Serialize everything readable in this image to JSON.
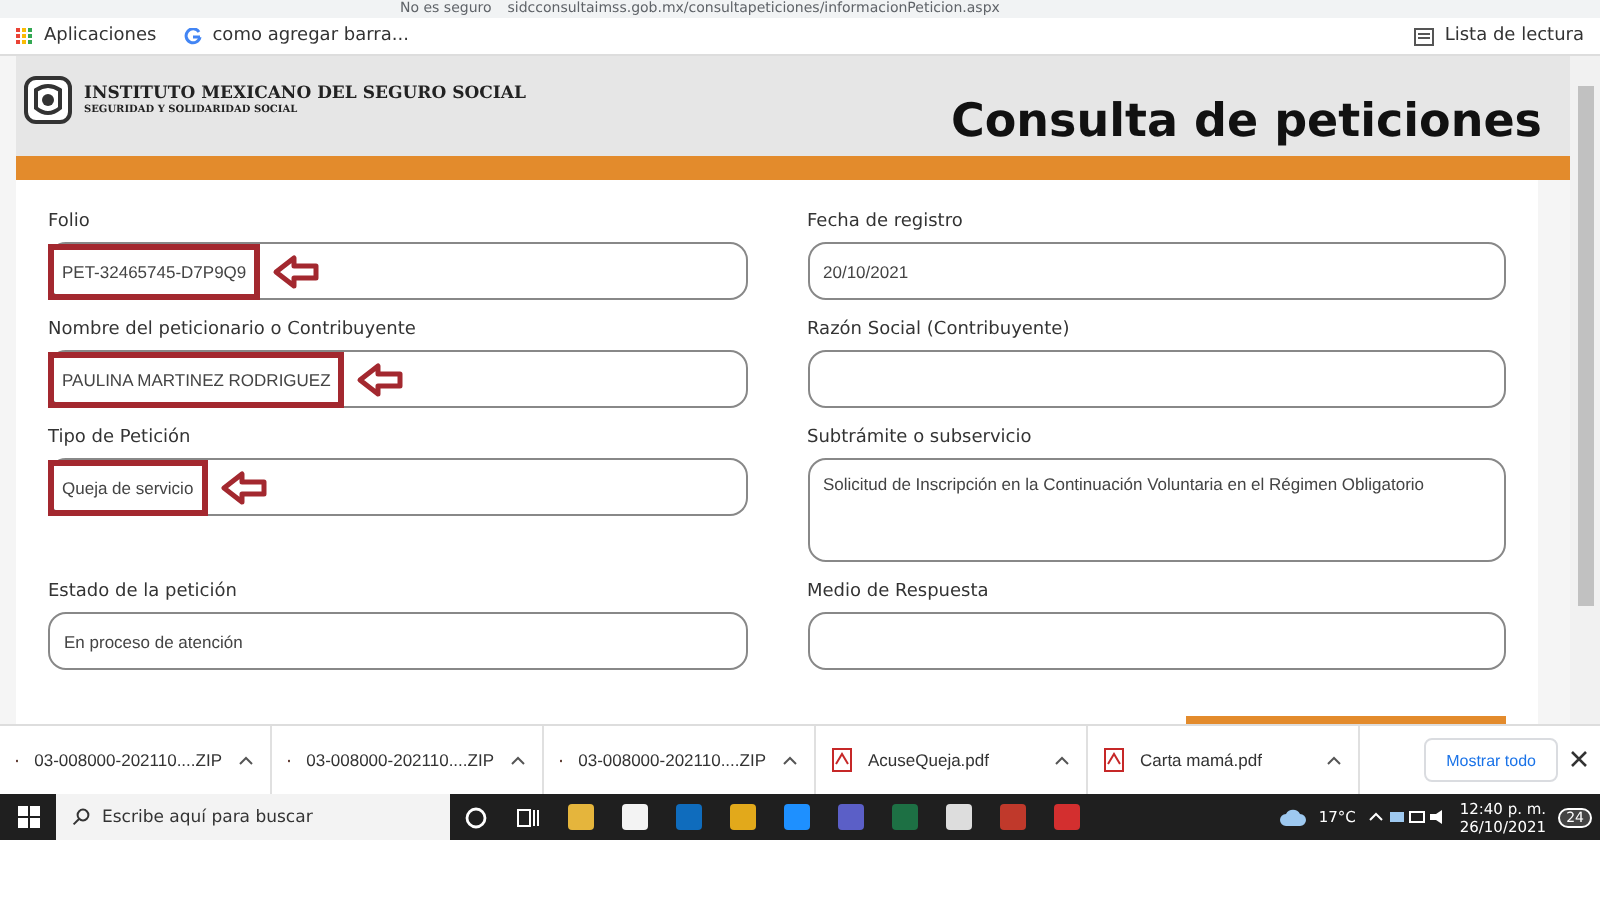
{
  "address_bar": {
    "security": "No es seguro",
    "url": "sidcconsultaimss.gob.mx/consultapeticiones/informacionPeticion.aspx"
  },
  "bookmarks": [
    {
      "label": "Aplicaciones",
      "kind": "apps"
    },
    {
      "label": "como agregar barra...",
      "kind": "google"
    }
  ],
  "reading_list": "Lista de lectura",
  "header": {
    "org_name": "INSTITUTO MEXICANO DEL SEGURO SOCIAL",
    "org_tagline": "SEGURIDAD Y SOLIDARIDAD SOCIAL",
    "title": "Consulta de peticiones"
  },
  "fields": [
    {
      "label": "Folio",
      "value": "PET-32465745-D7P9Q9",
      "highlighted": true,
      "tall": false
    },
    {
      "label": "Fecha de registro",
      "value": "20/10/2021",
      "highlighted": false,
      "tall": false
    },
    {
      "label": "Nombre del peticionario o Contribuyente",
      "value": "PAULINA MARTINEZ RODRIGUEZ",
      "highlighted": true,
      "tall": false
    },
    {
      "label": "Razón Social (Contribuyente)",
      "highlighted": false,
      "tall": false
    },
    {
      "label": "Tipo de Petición",
      "value": "Queja de servicio",
      "highlighted": true,
      "tall": false
    },
    {
      "label": "Subtrámite o subservicio",
      "value": "Solicitud de Inscripción en la Continuación Voluntaria en el Régimen Obligatorio",
      "highlighted": false,
      "tall": true
    },
    {
      "label": "Estado de la petición",
      "value": "En proceso de atención",
      "highlighted": false,
      "tall": false
    },
    {
      "label": "Medio de Respuesta",
      "highlighted": false,
      "tall": false
    }
  ],
  "downloads": [
    {
      "name": "03-008000-202110....ZIP",
      "kind": "zip"
    },
    {
      "name": "03-008000-202110....ZIP",
      "kind": "zip"
    },
    {
      "name": "03-008000-202110....ZIP",
      "kind": "zip"
    },
    {
      "name": "AcuseQueja.pdf",
      "kind": "pdf"
    },
    {
      "name": "Carta mamá.pdf",
      "kind": "pdf"
    }
  ],
  "show_all": "Mostrar todo",
  "taskbar": {
    "search_placeholder": "Escribe aquí para buscar",
    "temperature": "17°C",
    "time": "12:40 p. m.",
    "date": "26/10/2021",
    "notifications": "24"
  }
}
